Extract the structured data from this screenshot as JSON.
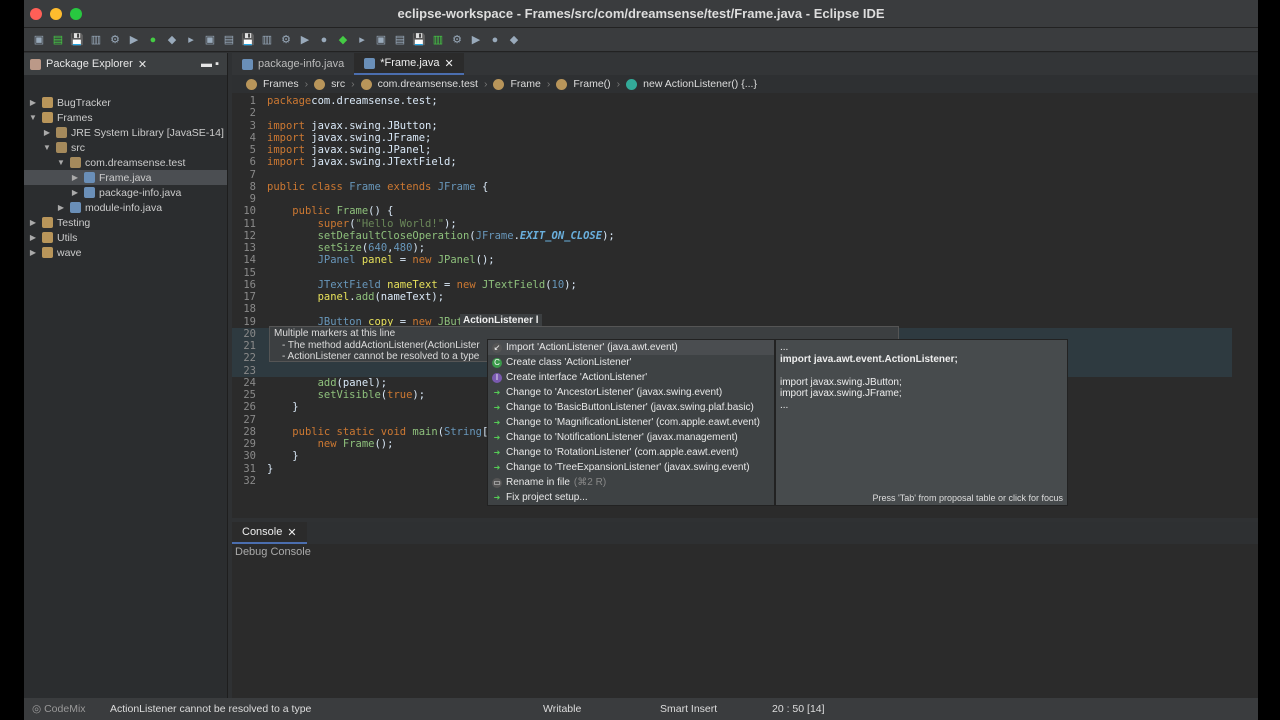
{
  "window": {
    "title": "eclipse-workspace - Frames/src/com/dreamsense/test/Frame.java - Eclipse IDE"
  },
  "package_explorer": {
    "title": "Package Explorer",
    "items": [
      {
        "label": "BugTracker",
        "depth": 0,
        "twisty": "▶"
      },
      {
        "label": "Frames",
        "depth": 0,
        "twisty": "▼"
      },
      {
        "label": "JRE System Library [JavaSE-14]",
        "depth": 1,
        "twisty": "▶"
      },
      {
        "label": "src",
        "depth": 1,
        "twisty": "▼"
      },
      {
        "label": "com.dreamsense.test",
        "depth": 2,
        "twisty": "▼"
      },
      {
        "label": "Frame.java",
        "depth": 3,
        "twisty": "▶",
        "selected": true
      },
      {
        "label": "package-info.java",
        "depth": 3,
        "twisty": "▶"
      },
      {
        "label": "module-info.java",
        "depth": 2,
        "twisty": "▶"
      },
      {
        "label": "Testing",
        "depth": 0,
        "twisty": "▶"
      },
      {
        "label": "Utils",
        "depth": 0,
        "twisty": "▶"
      },
      {
        "label": "wave",
        "depth": 0,
        "twisty": "▶"
      }
    ]
  },
  "editor": {
    "tabs": [
      {
        "label": "package-info.java"
      },
      {
        "label": "*Frame.java",
        "active": true
      }
    ],
    "breadcrumbs": [
      "Frames",
      "src",
      "com.dreamsense.test",
      "Frame",
      "Frame()",
      "new ActionListener() {...}"
    ],
    "lines": [
      [
        [
          "kw",
          "package"
        ],
        [
          "",
          "com.dreamsense.test;"
        ]
      ],
      [],
      [
        [
          "kw",
          "import"
        ],
        [
          "",
          " javax.swing.JButton;"
        ]
      ],
      [
        [
          "kw",
          "import"
        ],
        [
          "",
          " javax.swing.JFrame;"
        ]
      ],
      [
        [
          "kw",
          "import"
        ],
        [
          "",
          " javax.swing.JPanel;"
        ]
      ],
      [
        [
          "kw",
          "import"
        ],
        [
          "",
          " javax.swing.JTextField;"
        ]
      ],
      [],
      [
        [
          "kw",
          "public class "
        ],
        [
          "ty",
          "Frame"
        ],
        [
          "kw",
          " extends "
        ],
        [
          "ty",
          "JFrame"
        ],
        [
          "",
          " {"
        ]
      ],
      [],
      [
        [
          "",
          "    "
        ],
        [
          "kw",
          "public "
        ],
        [
          "fn",
          "Frame"
        ],
        [
          "",
          "() {"
        ]
      ],
      [
        [
          "",
          "        "
        ],
        [
          "kw",
          "super"
        ],
        [
          "",
          "("
        ],
        [
          "st",
          "\"Hello World!\""
        ],
        [
          "",
          ");"
        ]
      ],
      [
        [
          "",
          "        "
        ],
        [
          "fn",
          "setDefaultCloseOperation"
        ],
        [
          "",
          "("
        ],
        [
          "ty",
          "JFrame"
        ],
        [
          "",
          "."
        ],
        [
          "it",
          "EXIT_ON_CLOSE"
        ],
        [
          "",
          ");"
        ]
      ],
      [
        [
          "",
          "        "
        ],
        [
          "fn",
          "setSize"
        ],
        [
          "",
          "("
        ],
        [
          "nu",
          "640"
        ],
        [
          "",
          ","
        ],
        [
          "nu",
          "480"
        ],
        [
          "",
          ");"
        ]
      ],
      [
        [
          "",
          "        "
        ],
        [
          "ty",
          "JPanel "
        ],
        [
          "va",
          "panel"
        ],
        [
          "",
          " = "
        ],
        [
          "kw",
          "new "
        ],
        [
          "fn",
          "JPanel"
        ],
        [
          "",
          "();"
        ]
      ],
      [],
      [
        [
          "",
          "        "
        ],
        [
          "ty",
          "JTextField "
        ],
        [
          "va",
          "nameText"
        ],
        [
          "",
          " = "
        ],
        [
          "kw",
          "new "
        ],
        [
          "fn",
          "JTextField"
        ],
        [
          "",
          "("
        ],
        [
          "nu",
          "10"
        ],
        [
          "",
          ");"
        ]
      ],
      [
        [
          "",
          "        "
        ],
        [
          "va",
          "panel"
        ],
        [
          "",
          "."
        ],
        [
          "fn",
          "add"
        ],
        [
          "",
          "(nameText);"
        ]
      ],
      [],
      [
        [
          "",
          "        "
        ],
        [
          "ty",
          "JButton "
        ],
        [
          "va",
          "copy"
        ],
        [
          "",
          " = "
        ],
        [
          "kw",
          "new "
        ],
        [
          "fn",
          "JBut"
        ]
      ],
      [],
      [],
      [],
      [],
      [
        [
          "",
          "        "
        ],
        [
          "fn",
          "add"
        ],
        [
          "",
          "(panel);"
        ]
      ],
      [
        [
          "",
          "        "
        ],
        [
          "fn",
          "setVisible"
        ],
        [
          "",
          "("
        ],
        [
          "kw",
          "true"
        ],
        [
          "",
          ");"
        ]
      ],
      [
        [
          "",
          "    }"
        ]
      ],
      [],
      [
        [
          "",
          "    "
        ],
        [
          "kw",
          "public static void "
        ],
        [
          "fn",
          "main"
        ],
        [
          "",
          "("
        ],
        [
          "ty",
          "String"
        ],
        [
          "",
          "["
        ]
      ],
      [
        [
          "",
          "        "
        ],
        [
          "kw",
          "new "
        ],
        [
          "fn",
          "Frame"
        ],
        [
          "",
          "();"
        ]
      ],
      [
        [
          "",
          "    }"
        ]
      ],
      [
        [
          "",
          "}"
        ]
      ],
      []
    ],
    "inline_tip": "ActionListener l",
    "hover": {
      "title": "Multiple markers at this line",
      "lines": [
        "- The method addActionListener(ActionLister",
        "- ActionListener cannot be resolved to a type"
      ]
    },
    "proposals": [
      {
        "label": "Import 'ActionListener' (java.awt.event)",
        "icon": "import",
        "selected": true
      },
      {
        "label": "Create class 'ActionListener'",
        "icon": "class"
      },
      {
        "label": "Create interface 'ActionListener'",
        "icon": "interface"
      },
      {
        "label": "Change to 'AncestorListener' (javax.swing.event)",
        "icon": "change"
      },
      {
        "label": "Change to 'BasicButtonListener' (javax.swing.plaf.basic)",
        "icon": "change"
      },
      {
        "label": "Change to 'MagnificationListener' (com.apple.eawt.event)",
        "icon": "change"
      },
      {
        "label": "Change to 'NotificationListener' (javax.management)",
        "icon": "change"
      },
      {
        "label": "Change to 'RotationListener' (com.apple.eawt.event)",
        "icon": "change"
      },
      {
        "label": "Change to 'TreeExpansionListener' (javax.swing.event)",
        "icon": "change"
      },
      {
        "label": "Rename in file",
        "shortcut": "(⌘2 R)",
        "icon": "rename"
      },
      {
        "label": "Fix project setup...",
        "icon": "change"
      }
    ],
    "preview": {
      "lines": [
        "...",
        "import java.awt.event.ActionListener;",
        "",
        "import javax.swing.JButton;",
        "import javax.swing.JFrame;",
        "..."
      ],
      "footer": "Press 'Tab' from proposal table or click for focus"
    }
  },
  "console": {
    "tab": "Console",
    "subtitle": "Debug Console"
  },
  "status": {
    "codemix": "CodeMix",
    "message": "ActionListener cannot be resolved to a type",
    "writable": "Writable",
    "insert_mode": "Smart Insert",
    "position": "20 : 50 [14]"
  }
}
